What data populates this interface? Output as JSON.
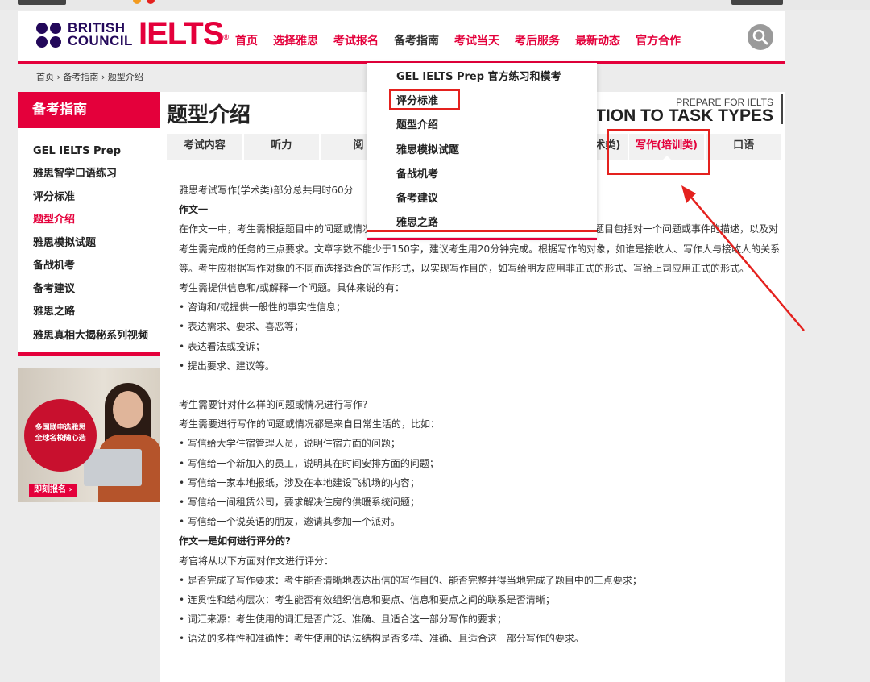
{
  "header": {
    "brand_line1": "BRITISH",
    "brand_line2": "COUNCIL",
    "product": "IELTS",
    "trademark": "®",
    "nav": [
      "首页",
      "选择雅思",
      "考试报名",
      "备考指南",
      "考试当天",
      "考后服务",
      "最新动态",
      "官方合作"
    ],
    "active_nav_index": 3,
    "search_icon": "search-icon"
  },
  "breadcrumb": "首页 › 备考指南 › 题型介绍",
  "sidebar": {
    "title": "备考指南",
    "items": [
      "GEL IELTS Prep",
      "雅思智学口语练习",
      "评分标准",
      "题型介绍",
      "雅思模拟试题",
      "备战机考",
      "备考建议",
      "雅思之路",
      "雅思真相大揭秘系列视频"
    ],
    "active_index": 3,
    "banner": {
      "text_line1": "多国联申选雅思",
      "text_line2": "全球名校随心选",
      "button": "即刻报名 ›"
    }
  },
  "main": {
    "title": "题型介绍",
    "prep_small": "PREPARE FOR IELTS",
    "prep_big": "DUCTION TO TASK TYPES",
    "tabs": [
      "考试内容",
      "听力",
      "阅",
      "",
      "",
      "写作(学术类)",
      "写作(培训类)",
      "口语"
    ],
    "active_tab_index": 6
  },
  "content": {
    "intro": "雅思考试写作(学术类)部分总共用时60分",
    "task1_heading": "作文一",
    "para1": "在作文一中，考生需根据题目中的问题或情况给出回应，文章风格可以是个人的、半正式或正式。题目包括对一个问题或事件的描述，以及对考生需完成的任务的三点要求。文章字数不能少于150字，建议考生用20分钟完成。根据写作的对象，如谁是接收人、写作人与接收人的关系等。考生应根据写作对象的不同而选择适合的写作形式，以实现写作目的，如写给朋友应用非正式的形式、写给上司应用正式的形式。",
    "para2": "考生需提供信息和/或解释一个问题。具体来说的有：",
    "list1": [
      "• 咨询和/或提供一般性的事实性信息；",
      "• 表达需求、要求、喜恶等；",
      "• 表达看法或投诉；",
      "• 提出要求、建议等。"
    ],
    "q1": "考生需要针对什么样的问题或情况进行写作?",
    "q1_answer": "考生需要进行写作的问题或情况都是来自日常生活的，比如：",
    "list2": [
      "• 写信给大学住宿管理人员，说明住宿方面的问题；",
      "• 写信给一个新加入的员工，说明其在时间安排方面的问题；",
      "• 写信给一家本地报纸，涉及在本地建设飞机场的内容；",
      "• 写信给一间租赁公司，要求解决住房的供暖系统问题；",
      "• 写信给一个说英语的朋友，邀请其参加一个派对。"
    ],
    "q2": "作文一是如何进行评分的?",
    "q2_answer": "考官将从以下方面对作文进行评分：",
    "list3": [
      "• 是否完成了写作要求：考生能否清晰地表达出信的写作目的、能否完整并得当地完成了题目中的三点要求；",
      "• 连贯性和结构层次：考生能否有效组织信息和要点、信息和要点之间的联系是否清晰；",
      "• 词汇来源：考生使用的词汇是否广泛、准确、且适合这一部分写作的要求；",
      "• 语法的多样性和准确性：考生使用的语法结构是否多样、准确、且适合这一部分写作的要求。"
    ]
  },
  "dropdown": {
    "items": [
      "GEL IELTS Prep 官方练习和模考",
      "评分标准",
      "题型介绍",
      "雅思模拟试题",
      "备战机考",
      "备考建议",
      "雅思之路"
    ],
    "highlight_index": 1
  },
  "colors": {
    "brand_red": "#e4003b",
    "brand_navy": "#23085a",
    "annotation_red": "#e4211e"
  }
}
